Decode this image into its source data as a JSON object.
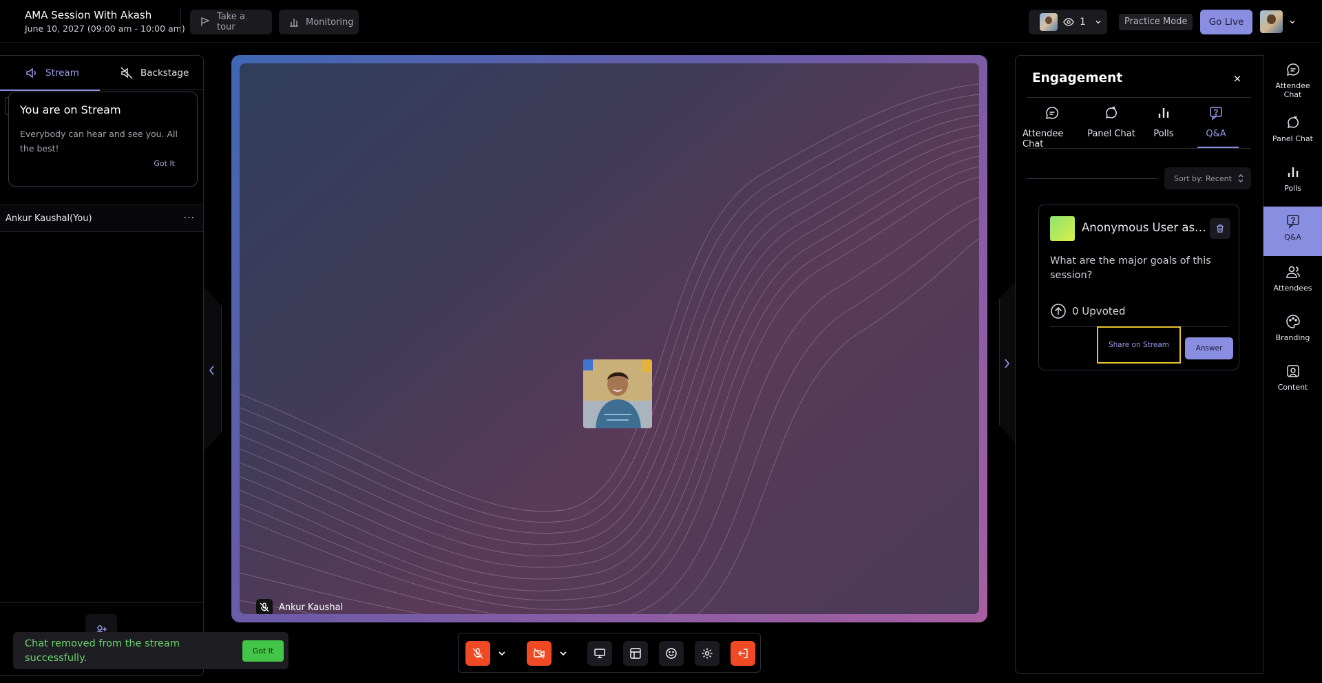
{
  "header": {
    "session_title": "AMA Session With Akash",
    "session_date": "June 10, 2027 (09:00 am - 10:00 am)",
    "tour_label": "Take a tour",
    "monitoring_label": "Monitoring",
    "viewer_count": "1",
    "practice_mode_label": "Practice Mode",
    "go_live_label": "Go Live"
  },
  "left_panel": {
    "tabs": [
      {
        "label": "Stream",
        "icon": "speaker-icon",
        "active": true
      },
      {
        "label": "Backstage",
        "icon": "speaker-off-icon",
        "active": false
      }
    ],
    "stream_card": {
      "title": "You are on Stream",
      "body": "Everybody can hear and see you. All the best!",
      "button": "Got It"
    },
    "user_row": {
      "name": "Ankur Kaushal(You)",
      "menu": "···"
    }
  },
  "stage": {
    "presenter_name": "Ankur Kaushal"
  },
  "toast": {
    "message": "Chat removed from the stream successfully.",
    "button": "Got It"
  },
  "engagement": {
    "title": "Engagement",
    "close": "×",
    "tabs": [
      {
        "label": "Attendee Chat",
        "icon": "chat-icon",
        "active": false
      },
      {
        "label": "Panel Chat",
        "icon": "panel-chat-icon",
        "active": false
      },
      {
        "label": "Polls",
        "icon": "poll-icon",
        "active": false
      },
      {
        "label": "Q&A",
        "icon": "qa-icon",
        "active": true
      }
    ],
    "sort_label": "Sort by: Recent",
    "question_card": {
      "user": "Anonymous User asked",
      "question": "What are the major goals of this session?",
      "upvotes": "0 Upvoted",
      "share_label": "Share on Stream",
      "answer_label": "Answer"
    }
  },
  "rail": {
    "items": [
      {
        "label": "Attendee Chat",
        "icon": "chat-icon",
        "active": false
      },
      {
        "label": "Panel Chat",
        "icon": "panel-chat-icon",
        "active": false
      },
      {
        "label": "Polls",
        "icon": "poll-icon",
        "active": false
      },
      {
        "label": "Q&A",
        "icon": "qa-icon",
        "active": true
      },
      {
        "label": "Attendees",
        "icon": "attendees-icon",
        "active": false
      },
      {
        "label": "Branding",
        "icon": "palette-icon",
        "active": false
      },
      {
        "label": "Content",
        "icon": "content-icon",
        "active": false
      }
    ]
  },
  "colors": {
    "accent": "#8a8ee0",
    "danger": "#f04a24",
    "success": "#43c548",
    "highlight": "#e8c330"
  }
}
